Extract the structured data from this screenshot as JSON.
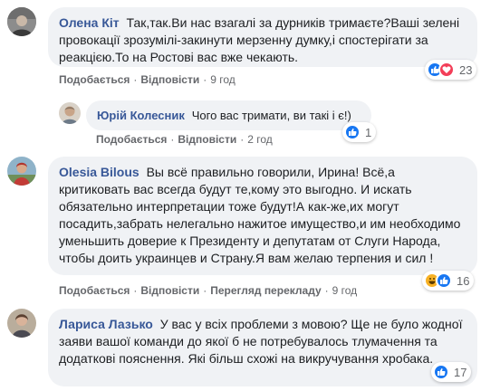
{
  "actions": {
    "like": "Подобається",
    "reply": "Відповісти",
    "translate": "Перегляд перекладу",
    "separator": "·"
  },
  "colors": {
    "link": "#385898",
    "bubble": "#f0f2f5",
    "meta": "#65676b",
    "like": "#1877f2",
    "love": "#f33e58",
    "haha": "#f7b125"
  },
  "comments": [
    {
      "author": "Олена Кіт",
      "text": "Так,так.Ви нас взагалі за дурників тримаєте?Ваші зелені провокації зрозумілі-закинути мерзенну думку,і спостерігати за реакцією.То на Ростові вас вже чекають.",
      "time": "9 год",
      "reactions": {
        "icons": [
          "like-icon",
          "love-icon"
        ],
        "count": "23"
      }
    },
    {
      "author": "Юрій Колесник",
      "text": "Чого вас тримати, ви такі і є!)",
      "time": "2 год",
      "reactions": {
        "icons": [
          "like-icon"
        ],
        "count": "1"
      }
    },
    {
      "author": "Olesia Bilous",
      "text": "Вы всё правильно говорили, Ирина! Всё,а критиковать вас всегда будут те,кому это выгодно. И искать обязательно интерпретации тоже будут!А как-же,их могут посадить,забрать нелегально нажитое имущество,и им необходимо уменьшить доверие к Президенту и депутатам от Слуги Народа, чтобы доить украинцев и Страну.Я вам желаю терпения и сил !",
      "time": "9 год",
      "reactions": {
        "icons": [
          "haha-icon",
          "like-icon"
        ],
        "count": "16"
      }
    },
    {
      "author": "Лариса Лазько",
      "text": "У вас у всіх проблеми з мовою? Ще не було жодної заяви вашої команди до якої б не потребувалось тлумачення та додаткові пояснення. Які більш схожі на викручування хробака.",
      "reactions": {
        "icons": [
          "like-icon"
        ],
        "count": "17"
      }
    }
  ]
}
